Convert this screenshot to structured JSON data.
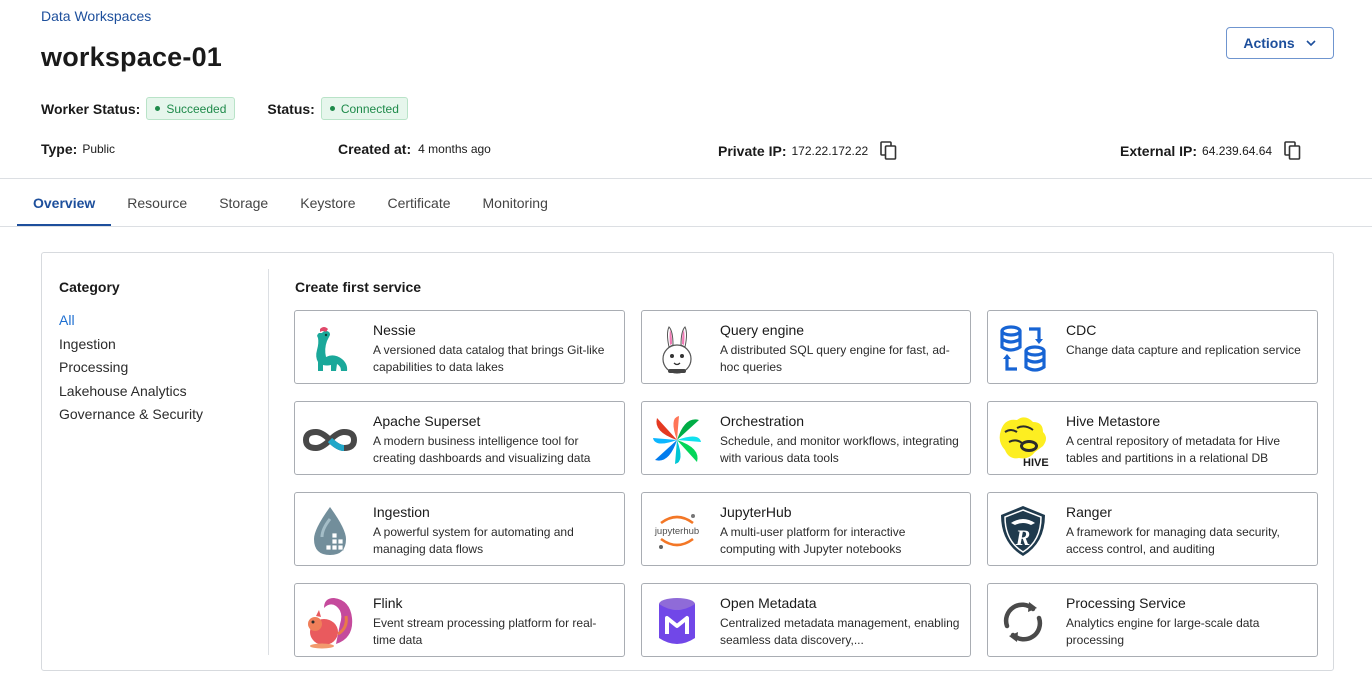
{
  "breadcrumb": "Data Workspaces",
  "title": "workspace-01",
  "actions_label": "Actions",
  "worker_status": {
    "label": "Worker Status:",
    "value": "Succeeded"
  },
  "status": {
    "label": "Status:",
    "value": "Connected"
  },
  "info": {
    "type": {
      "label": "Type:",
      "value": "Public"
    },
    "created": {
      "label": "Created at:",
      "value": "4 months ago"
    },
    "private_ip": {
      "label": "Private IP:",
      "value": "172.22.172.22"
    },
    "external_ip": {
      "label": "External IP:",
      "value": "64.239.64.64"
    }
  },
  "tabs": [
    "Overview",
    "Resource",
    "Storage",
    "Keystore",
    "Certificate",
    "Monitoring"
  ],
  "category": {
    "title": "Category",
    "items": [
      "All",
      "Ingestion",
      "Processing",
      "Lakehouse Analytics",
      "Governance & Security"
    ]
  },
  "services_title": "Create first service",
  "services": [
    {
      "name": "Nessie",
      "desc": "A versioned data catalog that brings Git-like capabilities to data lakes",
      "icon": "nessie-icon"
    },
    {
      "name": "Query engine",
      "desc": "A distributed SQL query engine for fast, ad-hoc queries",
      "icon": "query-engine-bunny-icon"
    },
    {
      "name": "CDC",
      "desc": "Change data capture and replication service",
      "icon": "cdc-database-icon"
    },
    {
      "name": "Apache Superset",
      "desc": "A modern business intelligence tool for creating dashboards and visualizing data",
      "icon": "superset-icon"
    },
    {
      "name": "Orchestration",
      "desc": "Schedule, and monitor workflows, integrating with various data tools",
      "icon": "pinwheel-icon"
    },
    {
      "name": "Hive Metastore",
      "desc": "A central repository of metadata for Hive tables and partitions in a relational DB",
      "icon": "hive-bee-icon"
    },
    {
      "name": "Ingestion",
      "desc": "A powerful system for automating and managing data flows",
      "icon": "ingestion-drop-icon"
    },
    {
      "name": "JupyterHub",
      "desc": "A multi-user platform for interactive computing with Jupyter notebooks",
      "icon": "jupyterhub-icon"
    },
    {
      "name": "Ranger",
      "desc": "A framework for managing data security, access control, and auditing",
      "icon": "ranger-shield-icon"
    },
    {
      "name": "Flink",
      "desc": "Event stream processing platform for real-time data",
      "icon": "flink-squirrel-icon"
    },
    {
      "name": "Open Metadata",
      "desc": "Centralized metadata management, enabling seamless data discovery,...",
      "icon": "open-metadata-icon"
    },
    {
      "name": "Processing Service",
      "desc": "Analytics engine for large-scale data processing",
      "icon": "refresh-arrows-icon"
    }
  ],
  "logo_text": {
    "jupyter": "jupyterhub",
    "hive": "HIVE",
    "ranger": "R"
  },
  "colors": {
    "accent": "#1d4f9c",
    "success": "#1e8a4a",
    "success_bg": "#e6f6ec",
    "active_category": "#1d6fd1"
  }
}
